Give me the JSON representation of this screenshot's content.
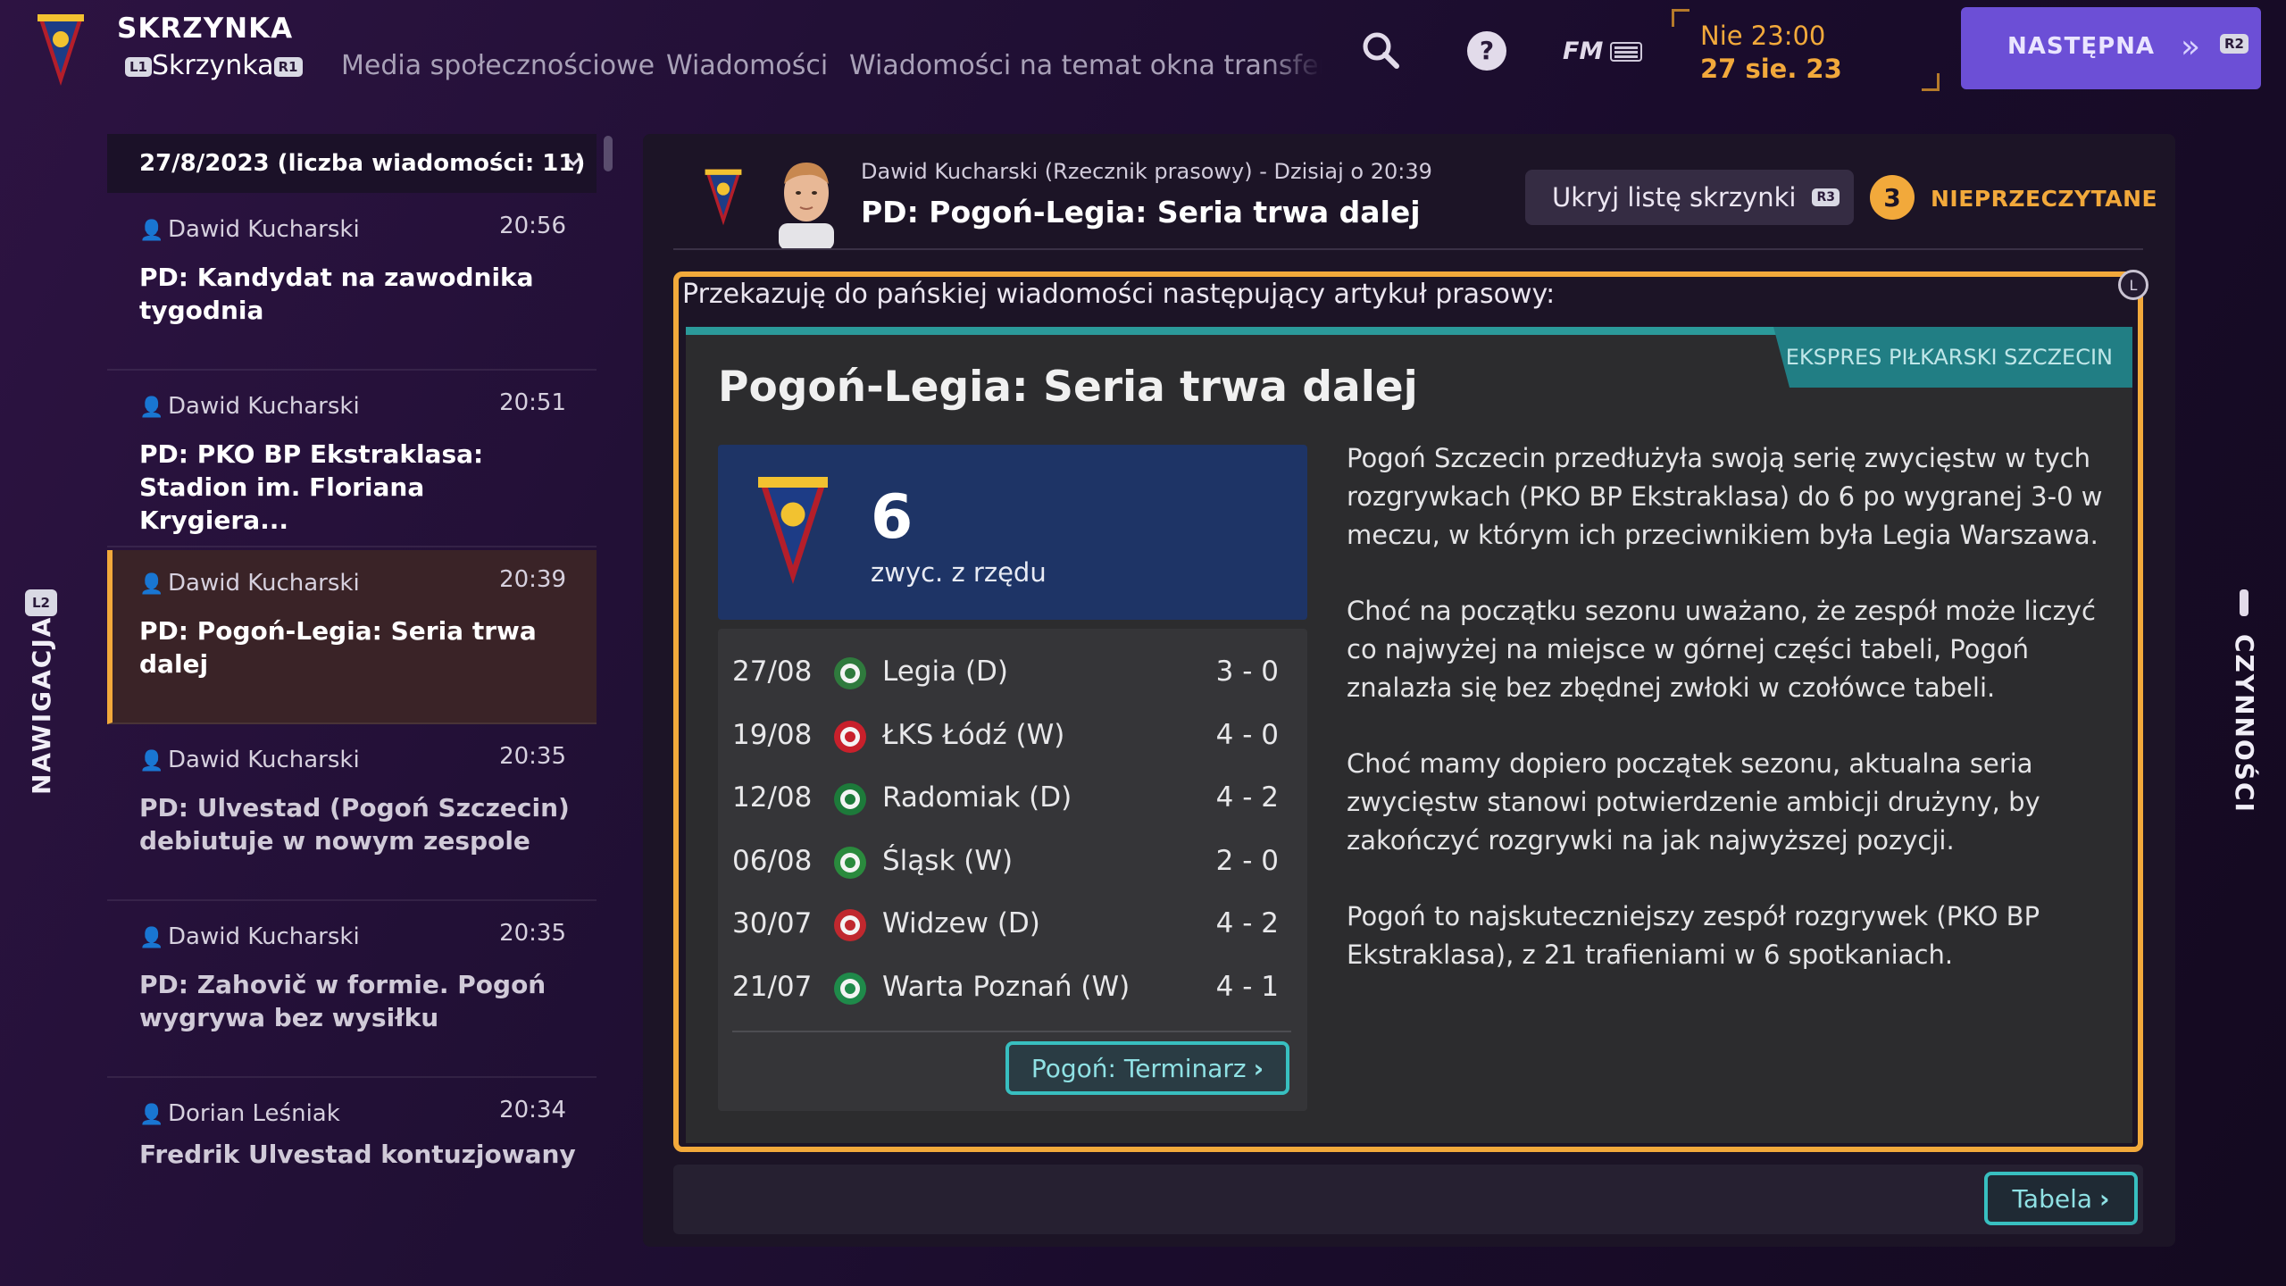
{
  "colors": {
    "accent": "#f2a93b",
    "primary_button": "#6c4fd6",
    "teal": "#38bfc0",
    "streak_bg": "#1e3466"
  },
  "top": {
    "app_title": "SKRZYNKA",
    "tabs": [
      {
        "badge_left": "L1",
        "label": "Skrzynka",
        "badge_right": "R1"
      },
      {
        "label": "Media społecznościowe"
      },
      {
        "label": "Wiadomości"
      },
      {
        "label": "Wiadomości na temat okna transferowego"
      }
    ],
    "icons": {
      "search": "search-icon",
      "help": "help-icon",
      "fm": "FM"
    },
    "fm_label": "FM",
    "time": "Nie 23:00",
    "date": "27 sie. 23",
    "next_button": {
      "label": "NASTĘPNA",
      "badge": "R2"
    }
  },
  "side": {
    "left_label": "NAWIGACJA",
    "left_badge": "L2",
    "right_label": "CZYNNOŚCI"
  },
  "inbox": {
    "header": "27/8/2023 (liczba wiadomości: 11)",
    "messages": [
      {
        "sender": "Dawid Kucharski",
        "time": "20:56",
        "subject": "PD: Kandydat na zawodnika tygodnia"
      },
      {
        "sender": "Dawid Kucharski",
        "time": "20:51",
        "subject": "PD: PKO BP Ekstraklasa: Stadion im. Floriana Krygiera..."
      },
      {
        "sender": "Dawid Kucharski",
        "time": "20:39",
        "subject": "PD: Pogoń-Legia: Seria trwa dalej"
      },
      {
        "sender": "Dawid Kucharski",
        "time": "20:35",
        "subject": "PD: Ulvestad (Pogoń Szczecin) debiutuje w nowym zespole"
      },
      {
        "sender": "Dawid Kucharski",
        "time": "20:35",
        "subject": "PD: Zahovič w formie. Pogoń wygrywa bez wysiłku"
      },
      {
        "sender": "Dorian Leśniak",
        "time": "20:34",
        "subject": "Fredrik Ulvestad kontuzjowany"
      }
    ]
  },
  "message": {
    "sender_meta": "Dawid Kucharski (Rzecznik prasowy) - Dzisiaj o 20:39",
    "subject": "PD: Pogoń-Legia: Seria trwa dalej",
    "hide_list_label": "Ukryj listę skrzynki",
    "hide_list_badge": "R3",
    "unread_count": "3",
    "unread_label": "NIEPRZECZYTANE",
    "l_badge": "L",
    "intro": "Przekazuję do pańskiej wiadomości następujący artykuł prasowy:",
    "article": {
      "source": "EKSPRES PIŁKARSKI SZCZECIN",
      "title": "Pogoń-Legia: Seria trwa dalej",
      "streak_number": "6",
      "streak_label": "zwyc. z rzędu",
      "results": [
        {
          "date": "27/08",
          "team": "Legia (D)",
          "score": "3 - 0",
          "logo_color": "#2f7a3d"
        },
        {
          "date": "19/08",
          "team": "ŁKS Łódź (W)",
          "score": "4 - 0",
          "logo_color": "#c8202b"
        },
        {
          "date": "12/08",
          "team": "Radomiak (D)",
          "score": "4 - 2",
          "logo_color": "#1d7a3a"
        },
        {
          "date": "06/08",
          "team": "Śląsk (W)",
          "score": "2 - 0",
          "logo_color": "#2a8a3d"
        },
        {
          "date": "30/07",
          "team": "Widzew (D)",
          "score": "4 - 2",
          "logo_color": "#c0282e"
        },
        {
          "date": "21/07",
          "team": "Warta Poznań (W)",
          "score": "4 - 1",
          "logo_color": "#1f8a4a"
        }
      ],
      "fixtures_button": "Pogoń: Terminarz",
      "paragraphs": [
        "Pogoń Szczecin przedłużyła swoją serię zwycięstw w tych rozgrywkach (PKO BP Ekstraklasa) do 6 po wygranej 3-0 w meczu, w którym ich przeciwnikiem była Legia Warszawa.",
        "Choć na początku sezonu uważano, że zespół może liczyć co najwyżej na miejsce w górnej części tabeli, Pogoń znalazła się bez zbędnej zwłoki w czołówce tabeli.",
        "Choć mamy dopiero początek sezonu, aktualna seria zwycięstw stanowi potwierdzenie ambicji drużyny, by zakończyć rozgrywki na jak najwyższej pozycji.",
        "Pogoń to najskuteczniejszy zespół rozgrywek (PKO BP Ekstraklasa), z 21 trafieniami w 6 spotkaniach."
      ]
    },
    "table_button": "Tabela"
  }
}
